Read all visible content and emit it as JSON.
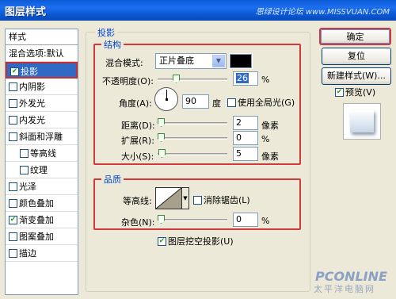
{
  "window": {
    "title": "图层样式",
    "watermark_top": "思绿设计论坛 www.MISSVUAN.COM"
  },
  "sidebar": {
    "header": "样式",
    "items": [
      {
        "label": "混合选项:默认",
        "checkbox": false,
        "checked": false,
        "sub": false,
        "selected": false
      },
      {
        "label": "投影",
        "checkbox": true,
        "checked": true,
        "sub": false,
        "selected": true
      },
      {
        "label": "内阴影",
        "checkbox": true,
        "checked": false,
        "sub": false,
        "selected": false
      },
      {
        "label": "外发光",
        "checkbox": true,
        "checked": false,
        "sub": false,
        "selected": false
      },
      {
        "label": "内发光",
        "checkbox": true,
        "checked": false,
        "sub": false,
        "selected": false
      },
      {
        "label": "斜面和浮雕",
        "checkbox": true,
        "checked": false,
        "sub": false,
        "selected": false
      },
      {
        "label": "等高线",
        "checkbox": true,
        "checked": false,
        "sub": true,
        "selected": false
      },
      {
        "label": "纹理",
        "checkbox": true,
        "checked": false,
        "sub": true,
        "selected": false
      },
      {
        "label": "光泽",
        "checkbox": true,
        "checked": false,
        "sub": false,
        "selected": false
      },
      {
        "label": "颜色叠加",
        "checkbox": true,
        "checked": false,
        "sub": false,
        "selected": false
      },
      {
        "label": "渐变叠加",
        "checkbox": true,
        "checked": true,
        "sub": false,
        "selected": false
      },
      {
        "label": "图案叠加",
        "checkbox": true,
        "checked": false,
        "sub": false,
        "selected": false
      },
      {
        "label": "描边",
        "checkbox": true,
        "checked": false,
        "sub": false,
        "selected": false
      }
    ]
  },
  "shadow": {
    "group_title": "投影",
    "structure": {
      "title": "结构",
      "blend_mode_label": "混合模式:",
      "blend_mode_value": "正片叠底",
      "shadow_color": "#000000",
      "opacity_label": "不透明度(O):",
      "opacity_value": "26",
      "opacity_unit": "%",
      "angle_label": "角度(A):",
      "angle_value": "90",
      "angle_unit": "度",
      "global_light_label": "使用全局光(G)",
      "global_light_checked": false,
      "distance_label": "距离(D):",
      "distance_value": "2",
      "distance_unit": "像素",
      "spread_label": "扩展(R):",
      "spread_value": "0",
      "spread_unit": "%",
      "size_label": "大小(S):",
      "size_value": "5",
      "size_unit": "像素"
    },
    "quality": {
      "title": "品质",
      "contour_label": "等高线:",
      "antialias_label": "消除锯齿(L)",
      "antialias_checked": false,
      "noise_label": "杂色(N):",
      "noise_value": "0",
      "noise_unit": "%"
    },
    "knockout_label": "图层挖空投影(U)",
    "knockout_checked": true
  },
  "buttons": {
    "ok": "确定",
    "reset": "复位",
    "new_style": "新建样式(W)...",
    "preview_label": "预览(V)",
    "preview_checked": true
  },
  "watermark": {
    "logo": "PCONLINE",
    "sub": "太平洋电脑网"
  }
}
